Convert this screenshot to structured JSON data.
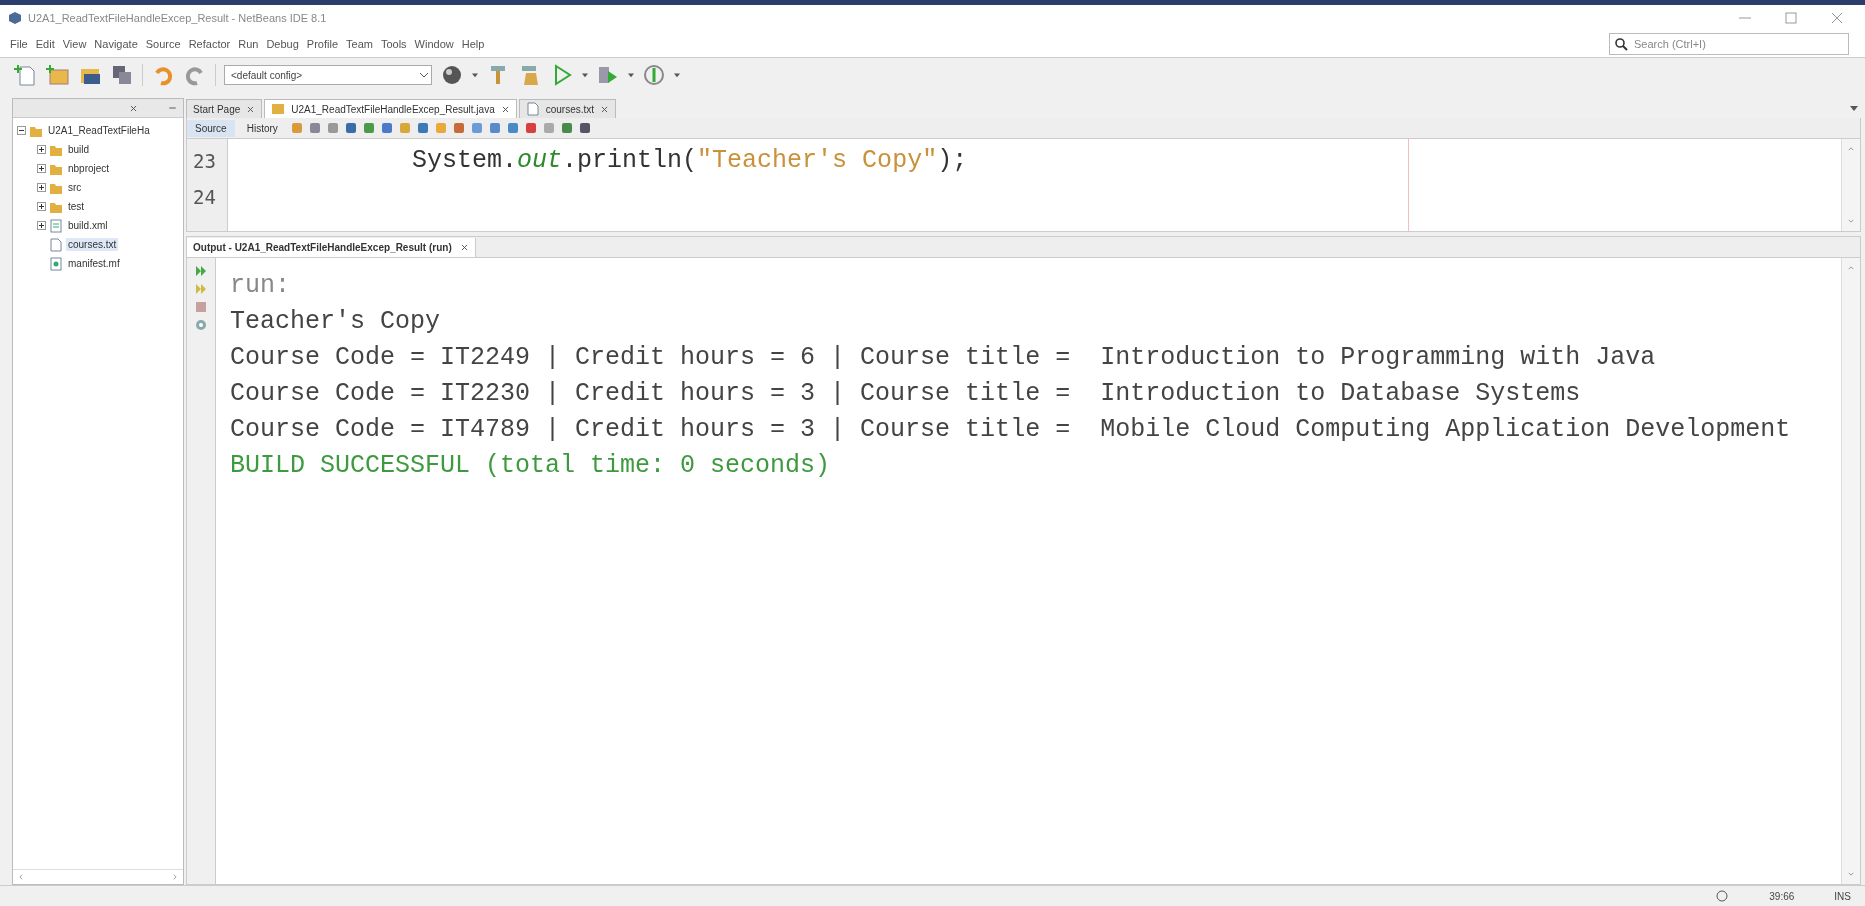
{
  "window": {
    "title": "U2A1_ReadTextFileHandleExcep_Result - NetBeans IDE 8.1"
  },
  "menu": [
    "File",
    "Edit",
    "View",
    "Navigate",
    "Source",
    "Refactor",
    "Run",
    "Debug",
    "Profile",
    "Team",
    "Tools",
    "Window",
    "Help"
  ],
  "toolbar": {
    "config": "<default config>"
  },
  "search": {
    "placeholder": "Search (Ctrl+I)"
  },
  "project_tree": [
    {
      "label": "U2A1_ReadTextFileHa",
      "kind": "project",
      "expanded": true,
      "selected": false,
      "children": [
        {
          "label": "build",
          "kind": "folder",
          "expanded": false,
          "selected": false
        },
        {
          "label": "nbproject",
          "kind": "folder",
          "expanded": false,
          "selected": false
        },
        {
          "label": "src",
          "kind": "folder",
          "expanded": false,
          "selected": false
        },
        {
          "label": "test",
          "kind": "folder",
          "expanded": false,
          "selected": false
        },
        {
          "label": "build.xml",
          "kind": "xml",
          "expanded": false,
          "selected": false
        },
        {
          "label": "courses.txt",
          "kind": "file",
          "selected": true
        },
        {
          "label": "manifest.mf",
          "kind": "manifest",
          "selected": false
        }
      ]
    }
  ],
  "editor_tabs": [
    {
      "label": "Start Page",
      "selected": false
    },
    {
      "label": "U2A1_ReadTextFileHandleExcep_Result.java",
      "selected": true
    },
    {
      "label": "courses.txt",
      "selected": false
    }
  ],
  "editor_views": [
    {
      "label": "Source",
      "selected": true
    },
    {
      "label": "History",
      "selected": false
    }
  ],
  "code_lines": [
    {
      "number": "23",
      "parts": [
        {
          "kind": "plain",
          "text": "            System."
        },
        {
          "kind": "field",
          "text": "out"
        },
        {
          "kind": "plain",
          "text": ".println("
        },
        {
          "kind": "string",
          "text": "\"Teacher's Copy\""
        },
        {
          "kind": "plain",
          "text": ");"
        }
      ]
    },
    {
      "number": "24"
    }
  ],
  "output": {
    "title": "Output - U2A1_ReadTextFileHandleExcep_Result (run)",
    "lines": [
      {
        "kind": "muted",
        "text": "run:"
      },
      {
        "kind": "normal",
        "text": "Teacher's Copy"
      },
      {
        "kind": "normal",
        "text": "Course Code = IT2249 | Credit hours = 6 | Course title =  Introduction to Programming with Java"
      },
      {
        "kind": "normal",
        "text": "Course Code = IT2230 | Credit hours = 3 | Course title =  Introduction to Database Systems"
      },
      {
        "kind": "normal",
        "text": "Course Code = IT4789 | Credit hours = 3 | Course title =  Mobile Cloud Computing Application Development"
      },
      {
        "kind": "success",
        "text": "BUILD SUCCESSFUL (total time: 0 seconds)"
      }
    ]
  },
  "status_bar": {
    "position": "39:66",
    "mode": "INS"
  }
}
